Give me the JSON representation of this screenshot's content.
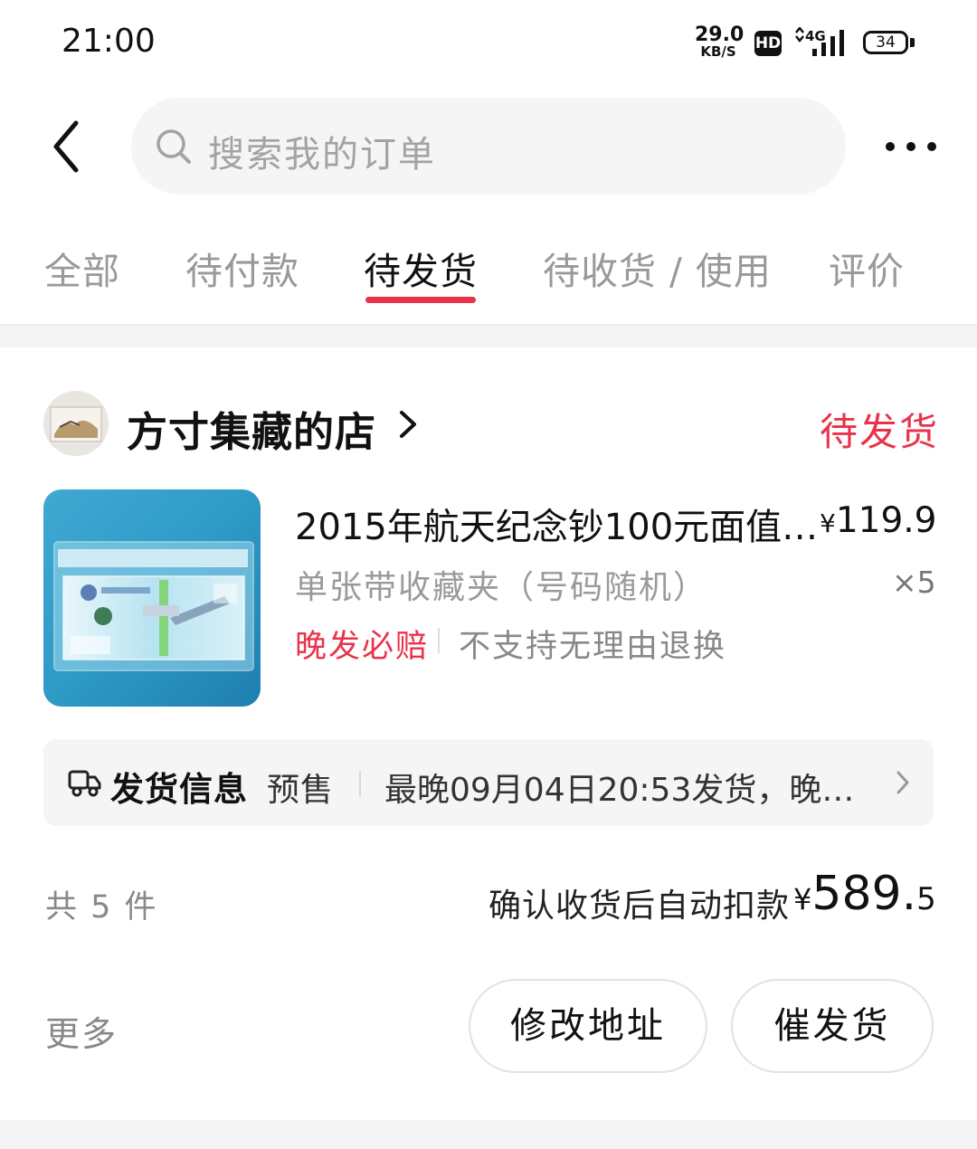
{
  "status_bar": {
    "time": "21:00",
    "net_speed_value": "29.0",
    "net_speed_unit": "KB/S",
    "hd_label": "HD",
    "network_label": "4G",
    "battery": "34"
  },
  "search": {
    "placeholder": "搜索我的订单",
    "icon": "search-icon"
  },
  "tabs": [
    {
      "label": "全部",
      "active": false
    },
    {
      "label": "待付款",
      "active": false
    },
    {
      "label": "待发货",
      "active": true
    },
    {
      "label": "待收货 / 使用",
      "active": false
    },
    {
      "label": "评价",
      "active": false
    }
  ],
  "order": {
    "shop_name": "方寸集藏的店",
    "status": "待发货",
    "product": {
      "title": "2015年航天纪念钞100元面值…",
      "price_symbol": "¥",
      "price": "119.9",
      "variant": "单张带收藏夹（号码随机）",
      "quantity": "×5",
      "tag_guarantee": "晚发必赔",
      "tag_return": "不支持无理由退换"
    },
    "shipping": {
      "label": "发货信息",
      "type": "预售",
      "detail": "最晚09月04日20:53发货，晚…"
    },
    "summary": {
      "count": "共 5 件",
      "payment_label": "确认收货后自动扣款",
      "currency": "¥",
      "total_int": "589.",
      "total_dec": "5"
    },
    "actions": {
      "more": "更多",
      "change_address": "修改地址",
      "urge_shipping": "催发货"
    }
  },
  "colors": {
    "accent": "#e8334a",
    "muted_text": "#999999",
    "panel_bg": "#f5f5f5"
  }
}
